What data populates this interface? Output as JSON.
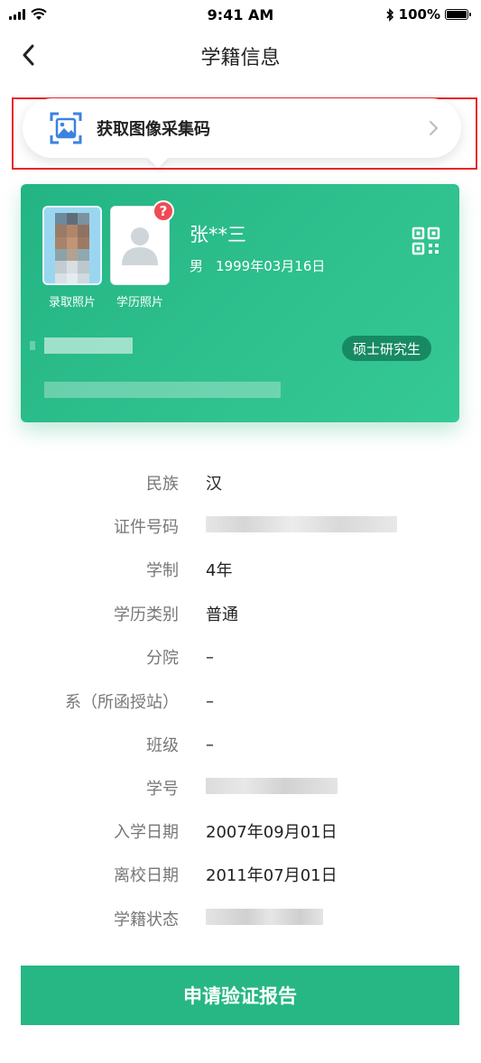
{
  "status_bar": {
    "time": "9:41 AM",
    "battery_text": "100%"
  },
  "nav": {
    "title": "学籍信息"
  },
  "collect_banner": {
    "label": "获取图像采集码"
  },
  "card": {
    "name": "张**三",
    "gender": "男",
    "birth_date": "1999年03月16日",
    "admission_photo_caption": "录取照片",
    "education_photo_caption": "学历照片",
    "badge": "?",
    "degree": "硕士研究生"
  },
  "info": [
    {
      "label": "民族",
      "value": "汉"
    },
    {
      "label": "证件号码",
      "value": ""
    },
    {
      "label": "学制",
      "value": "4年"
    },
    {
      "label": "学历类别",
      "value": "普通"
    },
    {
      "label": "分院",
      "value": "–"
    },
    {
      "label": "系（所函授站）",
      "value": "–"
    },
    {
      "label": "班级",
      "value": "–"
    },
    {
      "label": "学号",
      "value": ""
    },
    {
      "label": "入学日期",
      "value": "2007年09月01日"
    },
    {
      "label": "离校日期",
      "value": "2011年07月01日"
    },
    {
      "label": "学籍状态",
      "value": ""
    }
  ],
  "submit": {
    "label": "申请验证报告"
  },
  "colors": {
    "accent": "#26b784",
    "highlight": "#e8262b",
    "badge": "#ef4b57"
  }
}
